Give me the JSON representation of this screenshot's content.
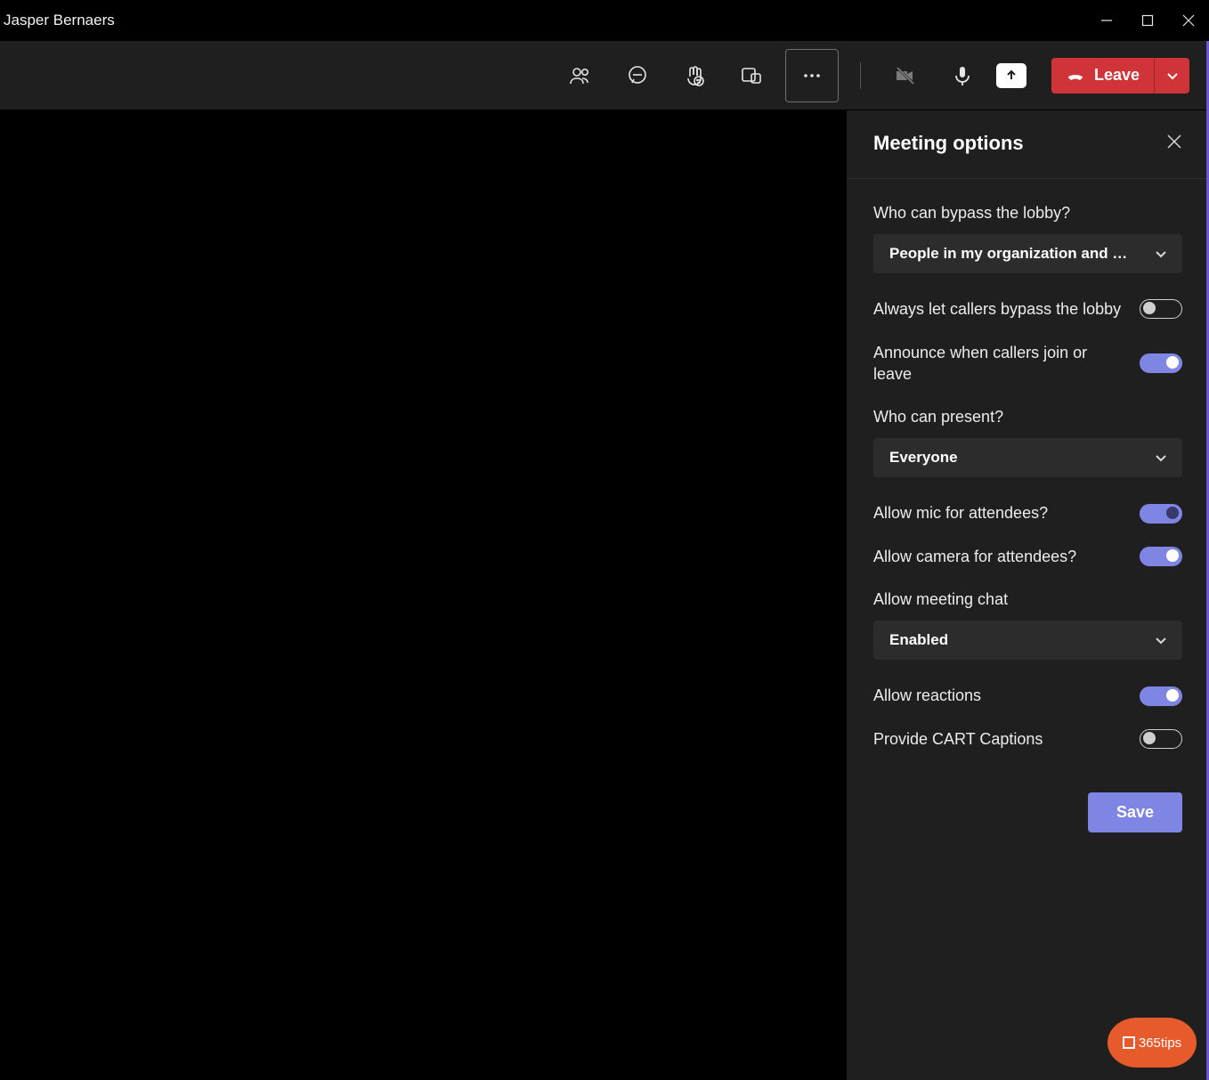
{
  "titlebar": {
    "title": "Jasper Bernaers"
  },
  "toolbar": {
    "leave_label": "Leave"
  },
  "panel": {
    "title": "Meeting options",
    "bypass_lobby": {
      "label": "Who can bypass the lobby?",
      "value": "People in my organization and …"
    },
    "callers_bypass": {
      "label": "Always let callers bypass the lobby",
      "value": false
    },
    "announce_callers": {
      "label": "Announce when callers join or leave",
      "value": true
    },
    "who_present": {
      "label": "Who can present?",
      "value": "Everyone"
    },
    "allow_mic": {
      "label": "Allow mic for attendees?",
      "value": true
    },
    "allow_camera": {
      "label": "Allow camera for attendees?",
      "value": true
    },
    "allow_chat": {
      "label": "Allow meeting chat",
      "value": "Enabled"
    },
    "allow_reactions": {
      "label": "Allow reactions",
      "value": true
    },
    "provide_cart": {
      "label": "Provide CART Captions",
      "value": false
    },
    "save_label": "Save"
  },
  "watermark": {
    "text": "365tips"
  }
}
